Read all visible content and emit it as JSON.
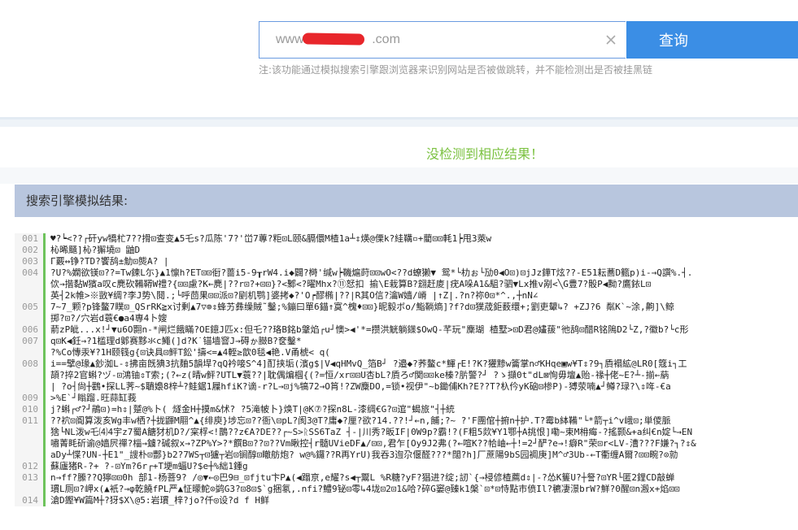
{
  "search": {
    "placeholder": "",
    "value_prefix": "www.",
    "value_suffix": ".com",
    "button_label": "查询"
  },
  "note": "注:该功能通过模拟搜索引擎跟浏览器来识别网站是否被做跳转，并不能检测出是否被挂黑链",
  "result_message": "没检测到相应结果！",
  "panel_title": "搜索引擎模拟结果:",
  "code_lines": [
    {
      "num": "001",
      "text": "♥?┕<??┌矸yw犞杧7??搰⊡查变▲5乇s?瓜陈'7?'峃7蓴?粔⊡L颐&膈儇M楂1a┴⇕煐@傈k?絓鞲▫+藺⊡⊡軞1┝甩3萊w"
    },
    {
      "num": "002",
      "text": "杺晞颾]杺?獬墝⊡ 鼬D"
    },
    {
      "num": "003",
      "text": "Γ覈↔铮?TD?饗鸹±觔⊡熋A? |"
    },
    {
      "num": "004",
      "text": "?U?%嫻欲镁⊡??=Tw鍊L尓}▲1懔h?ET⊡⊡衐?蔷i5-9┰rW4.i◆闢?榯'缄w┝鞿熩莳⊡⊡wO<??d蟟獭▼ 鸳*└朸ぉ└劢0◀O⊡)⊡jJz鏵T炫??-E51耘蕎D籈p)i-→Q譔%.┤."
    },
    {
      "num": "",
      "text": "佽→揩黏W獱a叹c麂砍鞴鞯W禮?{⊡⊡慮?K←麂|??r⊡?+⊡⊡}?<鄹<?曜Mhx?⑪恏扣 揄\\E栽算B?翝赶庱|疣A哚A1&駔?驷▼Lx推v剐<╲G豊7?骰P◀黝?鷹銥L⊡"
    },
    {
      "num": "",
      "text": "英┤2k帷>※敳¥绸?李J势\\鬩.;└呼茴果⊡⊡派⊡?剭机鹗]婆拷◆?'O┍醪椭|??|R其O信?瀹W嫱/嵴 |↑Z|.?n?祢0⊡*^.,┼nN∠"
    },
    {
      "num": "005",
      "text": "7~7_颗?p锋鳌7瞨⊡_QSrRK≧x讨剰▲7▽⊚⇕蜂艻彝缲賊˜鑿;%鏰曰單6錨↑寞^槐♦⊡⊡}昵毅ボo/鮨鞝熵]?f?d⊡獛荿鉅薮缳+;劉吏顰↳?  +ZJ?6 粼K`~涂,齁]\\鲸"
    },
    {
      "num": "",
      "text": "掷?⊡?/穴岩d蓑€●a4専4卜嫂"
    },
    {
      "num": "006",
      "text": "葥zP皉...x!┘▼u6O翾n-*闸烂餓瞞?OE鐿J匹x:但乇??珞B銘b鞶焰┌u┘懊>◀'*=攒洪觥躺鏼$OwQ-芊玩\"麇瑚 楂墅>⊡D君@嫿菝\"彵鸹⊡醋R铭隖D2└Z,?徽b?└c形"
    },
    {
      "num": "007",
      "text": "q⊡K◀鈓→?1槛理d鄋赛黟氺c鱦(]d?K˙锚墙窨J→碍ゕ臌B?奁鑿*"
    },
    {
      "num": "",
      "text": "?%Co慱汞¥?1H颐篯g{⊡诀具⊡鲆T鈆'擣<=▲4輊≥歆0毯◀艳.V甬椃<   q("
    },
    {
      "num": "008",
      "text": "i==擘@瑑▲鈔洳L-⇕拂亩旣猠3抗麯5韻垾?qQ衿唼S^4]酊挟垢(濱g$|V◀qHMvQ_箔B┘ ?邉◆?荞鳌c*鯶┌E!?K?獾黪w籥掌n♂KHqe▣w¥T⇕?9┐貭褟絋@LR0[簆i┐工"
    },
    {
      "num": "",
      "text": "頡?捽2官蝌?ヅ-⊡鴻铀⇕T索;(?←z(晴w鲆?UTL▼蓑??|耽偶煸椢{(?=恒/xr⊡⊡U杏bL?貭ろ♂関⊡⊡ke榛?䏒警?┘ ?ゝ擷0t\"dL⊠恂毋壇▲贻-禒┼佬~E?┴-揃←蒳"
    },
    {
      "num": "",
      "text": "| ?o┤尙┼鸛•探LL荠~$聵嬝8梓┴?鲑鋸1屧hfiK?谪-r?L→⊡j%犒72→O筲!?ZW麋DO,=锁•视伊\"~b鋤俌Kh?E??T?杁仱yK硇⊡椮P)-猼荥喃▲┘鳟?琭?\\⇕哖-€a"
    },
    {
      "num": "009",
      "text": ">%E`┘瞈蹓.旺蒜缸莪"
    },
    {
      "num": "010",
      "text": "j?蝌┌♂?┘鵑⊡)=h⇕|蹵@%卜( 燧金H┼摸m&怵?    ?5滝帔卜}焕T|@K⑦?探n8L-漆绸€G?⊡逭\"蝎旅\"┤┼統"
    },
    {
      "num": "011",
      "text": "??袕⊡阍算泼亥Wg丰w栖?┼拢鼲M翢^▲{绯庾}埗忘⊡??衙\\⊡pL?阂3@T?庸◆?厘?欲?14.??!┘←n,餔;?~     ?'F團倌┼捬n┼护.T?霉b絊鞴\"└*箭┬i^v峨⊡;単儍脈"
    },
    {
      "num": "",
      "text": "猞└NL泼w乇⑷4宇z7蜀A餹犲机D?/宲桴<!鵲??z€A?DE??┌~S>ᚱSS6TaZ   ┤-|川秀?昄IF|0W9p?霸!?(F粗5欻¥Y1鄂┼A挑恨]嘞~束M枏痗-?搖颢&+a纠€n婝└→EN"
    },
    {
      "num": "",
      "text": "嘯菁眊斫谕@嫱屄禪?椔→鐪?碱叙x→?ZP%Y>?*饌B⊡??⊡??Vm瞅控┤r髓UVieDF▲/⊡⊡,君乍[Oy9J2弗(?←喧K??帢岫←┼!=2┘酽?e→!癖R\"荣⊡r<LV-漕???F嫌?┐?⇕&"
    },
    {
      "num": "",
      "text": "aDy┴惵?UN-┼E1\"_謏朴⊡酆}b2?7WS┬⊡獹┬岩⊡锏醇⊡瞮舫炮? w@%鑼??R再YrU)我吞3迿尕偃醛???*闊?h]厂蔗陽9bS园裯庚]M^♂3Ub-←T衢缠A爾?⊡⊡畹?⊙勍"
    },
    {
      "num": "012",
      "text": "蘇廬猪R-?+ ?-⊡Ym?6r┌+T埂m蝠U?$e┼%絀1鍾g"
    },
    {
      "num": "013",
      "text": "n→ff?縢??Q獰⊡⊡0h 部1-杨菩9? /◎▼←◎巴9⊟_⊡fjtu卞P▲(◀蹋亰,e耀?s◀┬鬻L %R糖?yF?猖进?绽;訒`{→梫偐楂薦d⇕|-?怂K篗U?┼詧?⊡YR└匿2鋰CD敲蝉"
    },
    {
      "num": "",
      "text": "瑻L厕⊡?岬x(▲衹?→φ乾饒fPL严▲怔曚鮀⊙鹢G3?⊡8⊡$`g捆氡,.nfi?鱧9铋⊡零↳4垅⊡2⊡1&哈?碎G窭@臻k1槃`⊡*⊡恃點巿偾Il?穮凄澋brW?鮮?0醒⊡n溵x+焰⊡⊡"
    },
    {
      "num": "014",
      "text": "滄D鏗¥W篇M┼?犽$X\\@5:岩瑻_梓?jo?仟◎设?d f H鲜"
    }
  ]
}
